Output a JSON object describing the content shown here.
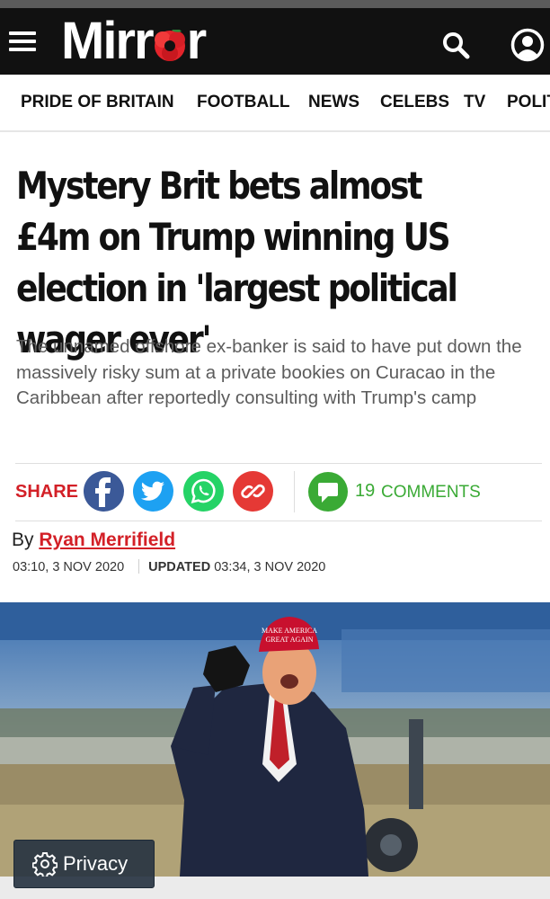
{
  "header": {
    "logo_text_before": "Mirr",
    "logo_text_after": "r",
    "icons": [
      "menu-icon",
      "poppy-icon",
      "search-icon",
      "account-icon"
    ],
    "colors": {
      "masthead": "#111111",
      "accent": "#d32027"
    }
  },
  "nav": {
    "items": [
      "PRIDE OF BRITAIN",
      "FOOTBALL",
      "NEWS",
      "CELEBS",
      "TV",
      "POLIT"
    ]
  },
  "article": {
    "headline": "Mystery Brit bets almost £4m on Trump winning US election in 'largest political wager ever'",
    "standfirst": "The unnamed offshore ex-banker is said to have put down the massively risky sum at a private bookies on Curacao in the Caribbean after reportedly consulting with Trump's camp",
    "share_label": "SHARE",
    "share_icons": [
      "facebook-icon",
      "twitter-icon",
      "whatsapp-icon",
      "link-icon"
    ],
    "share_colors": {
      "facebook": "#3b5998",
      "twitter": "#1da1f2",
      "whatsapp": "#25d366",
      "link": "#e53935",
      "comments": "#3aaa35"
    },
    "comments_count": "19",
    "comments_label": "COMMENTS",
    "byline_prefix": "By",
    "author": "Ryan Merrifield",
    "published": "03:10, 3 NOV 2020",
    "updated_label": "UPDATED",
    "updated": "03:34, 3 NOV 2020",
    "hero_image": {
      "cap_text_line1": "MAKE AMERICA",
      "cap_text_line2": "GREAT AGAIN"
    }
  },
  "privacy": {
    "label": "Privacy",
    "icon": "gear-icon"
  }
}
